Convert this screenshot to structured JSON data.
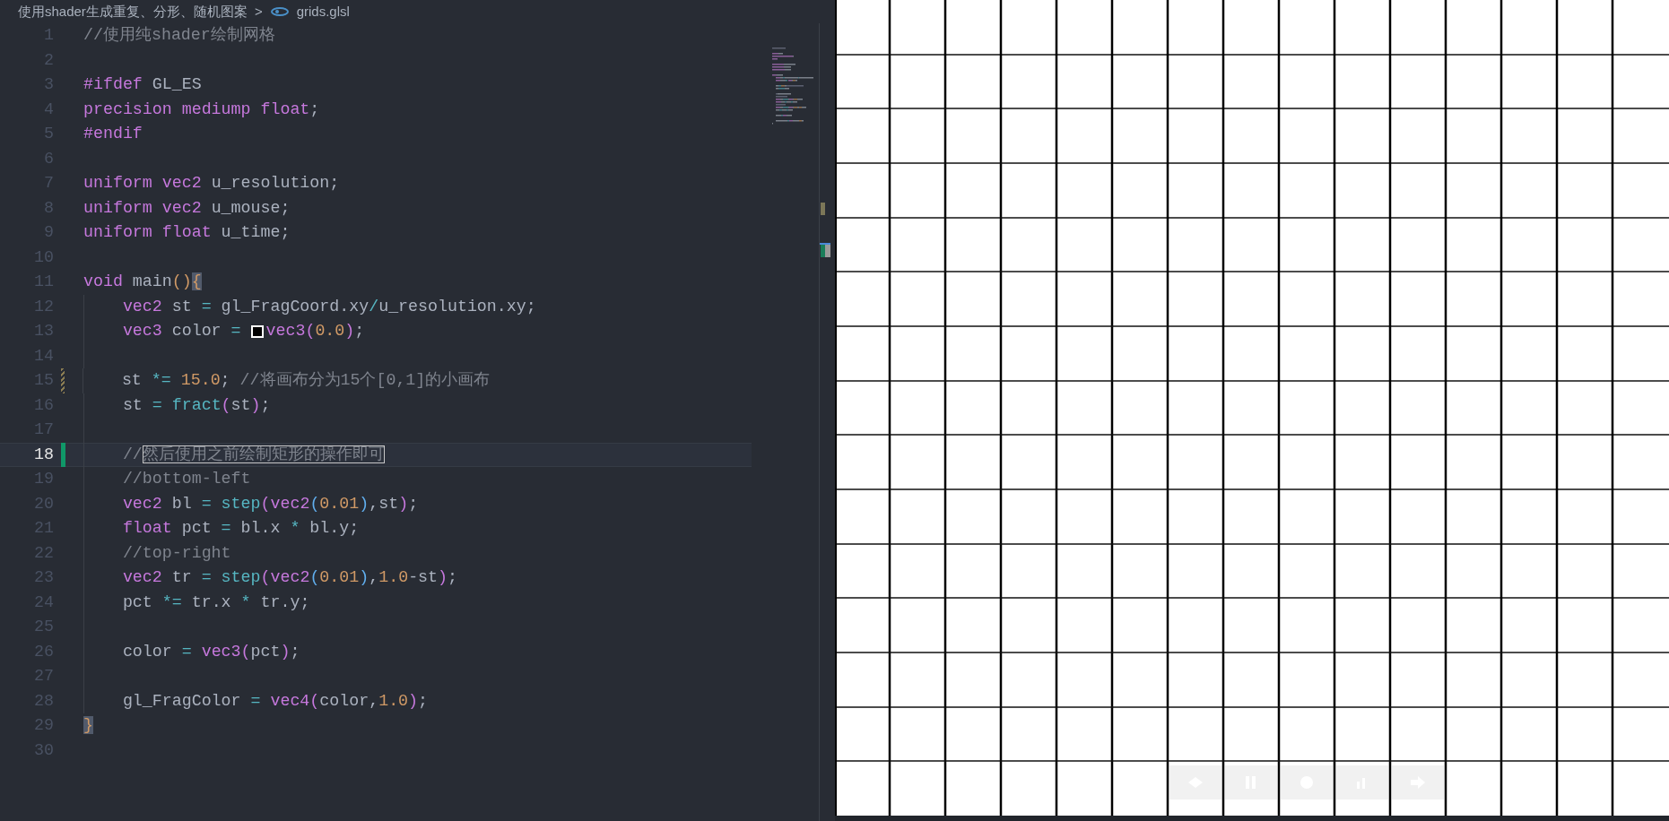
{
  "breadcrumb": {
    "folder": "使用shader生成重复、分形、随机图案",
    "separator": ">",
    "file": "grids.glsl"
  },
  "lines": [
    {
      "number": "1",
      "tokens": [
        {
          "kind": "comment",
          "text": "//使用纯shader绘制网格"
        }
      ]
    },
    {
      "number": "2"
    },
    {
      "number": "3",
      "tokens": [
        {
          "kind": "keyword",
          "text": "#ifdef "
        },
        {
          "kind": "plain",
          "text": "GL_ES"
        }
      ]
    },
    {
      "number": "4",
      "tokens": [
        {
          "kind": "keyword",
          "text": "precision mediump float"
        },
        {
          "kind": "plain",
          "text": ";"
        }
      ]
    },
    {
      "number": "5",
      "tokens": [
        {
          "kind": "keyword",
          "text": "#endif"
        }
      ]
    },
    {
      "number": "6"
    },
    {
      "number": "7",
      "tokens": [
        {
          "kind": "keyword",
          "text": "uniform vec2 "
        },
        {
          "kind": "plain",
          "text": "u_resolution;"
        }
      ]
    },
    {
      "number": "8",
      "tokens": [
        {
          "kind": "keyword",
          "text": "uniform vec2 "
        },
        {
          "kind": "plain",
          "text": "u_mouse;"
        }
      ]
    },
    {
      "number": "9",
      "tokens": [
        {
          "kind": "keyword",
          "text": "uniform float "
        },
        {
          "kind": "plain",
          "text": "u_time;"
        }
      ]
    },
    {
      "number": "10"
    },
    {
      "number": "11",
      "tokens": [
        {
          "kind": "keyword",
          "text": "void "
        },
        {
          "kind": "plain",
          "text": "main"
        },
        {
          "kind": "bracket1",
          "text": "()"
        },
        {
          "kind": "match",
          "text": "{"
        }
      ]
    },
    {
      "number": "12",
      "guide": true,
      "tokens": [
        {
          "kind": "keyword",
          "text": "vec2 "
        },
        {
          "kind": "plain",
          "text": "st "
        },
        {
          "kind": "operator",
          "text": "= "
        },
        {
          "kind": "plain",
          "text": "gl_FragCoord.xy"
        },
        {
          "kind": "operator",
          "text": "/"
        },
        {
          "kind": "plain",
          "text": "u_resolution.xy;"
        }
      ]
    },
    {
      "number": "13",
      "guide": true,
      "tokens": [
        {
          "kind": "keyword",
          "text": "vec3 "
        },
        {
          "kind": "plain",
          "text": "color "
        },
        {
          "kind": "operator",
          "text": "= "
        },
        {
          "kind": "swatch",
          "color": "#000000"
        },
        {
          "kind": "keyword",
          "text": "vec3"
        },
        {
          "kind": "bracket2",
          "text": "("
        },
        {
          "kind": "number",
          "text": "0.0"
        },
        {
          "kind": "bracket2",
          "text": ")"
        },
        {
          "kind": "plain",
          "text": ";"
        }
      ]
    },
    {
      "number": "14",
      "guide": true
    },
    {
      "number": "15",
      "guide": true,
      "modified": true,
      "tokens": [
        {
          "kind": "plain",
          "text": "st "
        },
        {
          "kind": "operator",
          "text": "*= "
        },
        {
          "kind": "number",
          "text": "15.0"
        },
        {
          "kind": "plain",
          "text": "; "
        },
        {
          "kind": "comment",
          "text": "//将画布分为15个[0,1]的小画布"
        }
      ]
    },
    {
      "number": "16",
      "guide": true,
      "tokens": [
        {
          "kind": "plain",
          "text": "st "
        },
        {
          "kind": "operator",
          "text": "= "
        },
        {
          "kind": "function",
          "text": "fract"
        },
        {
          "kind": "bracket2",
          "text": "("
        },
        {
          "kind": "plain",
          "text": "st"
        },
        {
          "kind": "bracket2",
          "text": ")"
        },
        {
          "kind": "plain",
          "text": ";"
        }
      ]
    },
    {
      "number": "17",
      "guide": true
    },
    {
      "number": "18",
      "guide": true,
      "current": true,
      "added": true,
      "tokens": [
        {
          "kind": "comment",
          "text": "//"
        },
        {
          "kind": "found",
          "text": "然后使用之前绘制矩形的操作即可"
        }
      ]
    },
    {
      "number": "19",
      "guide": true,
      "tokens": [
        {
          "kind": "comment",
          "text": "//bottom-left"
        }
      ]
    },
    {
      "number": "20",
      "guide": true,
      "tokens": [
        {
          "kind": "keyword",
          "text": "vec2 "
        },
        {
          "kind": "plain",
          "text": "bl "
        },
        {
          "kind": "operator",
          "text": "= "
        },
        {
          "kind": "function",
          "text": "step"
        },
        {
          "kind": "bracket2",
          "text": "("
        },
        {
          "kind": "keyword",
          "text": "vec2"
        },
        {
          "kind": "bracket3",
          "text": "("
        },
        {
          "kind": "number",
          "text": "0.01"
        },
        {
          "kind": "bracket3",
          "text": ")"
        },
        {
          "kind": "plain",
          "text": ",st"
        },
        {
          "kind": "bracket2",
          "text": ")"
        },
        {
          "kind": "plain",
          "text": ";"
        }
      ]
    },
    {
      "number": "21",
      "guide": true,
      "tokens": [
        {
          "kind": "keyword",
          "text": "float "
        },
        {
          "kind": "plain",
          "text": "pct "
        },
        {
          "kind": "operator",
          "text": "= "
        },
        {
          "kind": "plain",
          "text": "bl.x "
        },
        {
          "kind": "operator",
          "text": "* "
        },
        {
          "kind": "plain",
          "text": "bl.y;"
        }
      ]
    },
    {
      "number": "22",
      "guide": true,
      "tokens": [
        {
          "kind": "comment",
          "text": "//top-right"
        }
      ]
    },
    {
      "number": "23",
      "guide": true,
      "tokens": [
        {
          "kind": "keyword",
          "text": "vec2 "
        },
        {
          "kind": "plain",
          "text": "tr "
        },
        {
          "kind": "operator",
          "text": "= "
        },
        {
          "kind": "function",
          "text": "step"
        },
        {
          "kind": "bracket2",
          "text": "("
        },
        {
          "kind": "keyword",
          "text": "vec2"
        },
        {
          "kind": "bracket3",
          "text": "("
        },
        {
          "kind": "number",
          "text": "0.01"
        },
        {
          "kind": "bracket3",
          "text": ")"
        },
        {
          "kind": "plain",
          "text": ","
        },
        {
          "kind": "number",
          "text": "1.0"
        },
        {
          "kind": "plain",
          "text": "-st"
        },
        {
          "kind": "bracket2",
          "text": ")"
        },
        {
          "kind": "plain",
          "text": ";"
        }
      ]
    },
    {
      "number": "24",
      "guide": true,
      "tokens": [
        {
          "kind": "plain",
          "text": "pct "
        },
        {
          "kind": "operator",
          "text": "*= "
        },
        {
          "kind": "plain",
          "text": "tr.x "
        },
        {
          "kind": "operator",
          "text": "* "
        },
        {
          "kind": "plain",
          "text": "tr.y;"
        }
      ]
    },
    {
      "number": "25",
      "guide": true
    },
    {
      "number": "26",
      "guide": true,
      "tokens": [
        {
          "kind": "plain",
          "text": "color "
        },
        {
          "kind": "operator",
          "text": "= "
        },
        {
          "kind": "keyword",
          "text": "vec3"
        },
        {
          "kind": "bracket2",
          "text": "("
        },
        {
          "kind": "plain",
          "text": "pct"
        },
        {
          "kind": "bracket2",
          "text": ")"
        },
        {
          "kind": "plain",
          "text": ";"
        }
      ]
    },
    {
      "number": "27",
      "guide": true
    },
    {
      "number": "28",
      "guide": true,
      "tokens": [
        {
          "kind": "plain",
          "text": "gl_FragColor "
        },
        {
          "kind": "operator",
          "text": "= "
        },
        {
          "kind": "keyword",
          "text": "vec4"
        },
        {
          "kind": "bracket2",
          "text": "("
        },
        {
          "kind": "plain",
          "text": "color,"
        },
        {
          "kind": "number",
          "text": "1.0"
        },
        {
          "kind": "bracket2",
          "text": ")"
        },
        {
          "kind": "plain",
          "text": ";"
        }
      ]
    },
    {
      "number": "29",
      "tokens": [
        {
          "kind": "match",
          "text": "}"
        }
      ]
    },
    {
      "number": "30"
    }
  ]
}
